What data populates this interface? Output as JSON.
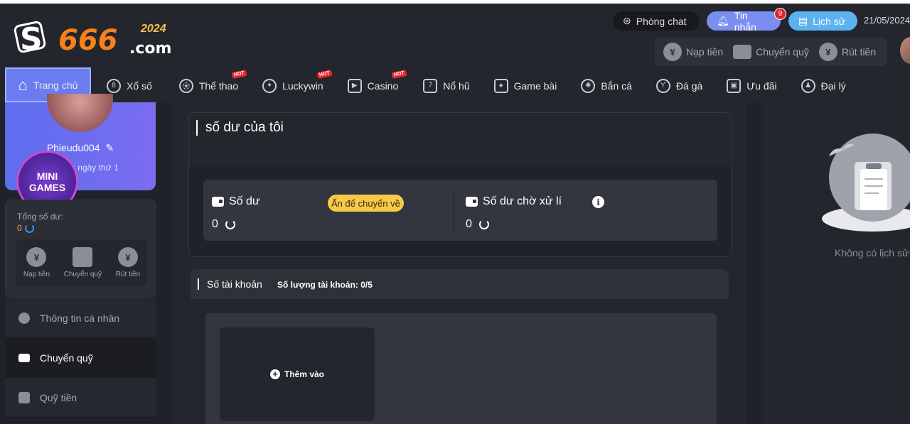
{
  "brand": {
    "logo_letters": "S",
    "logo_number": "666",
    "logo_domain": ".com",
    "logo_year": "2024"
  },
  "header": {
    "chat_label": "Phòng chat",
    "messages_label": "Tin nhắn",
    "messages_count": "9",
    "history_label": "Lịch sử",
    "date": "21/05/2024",
    "wallet": {
      "deposit": "Nạp tiền",
      "transfer": "Chuyển quỹ",
      "withdraw": "Rút tiền"
    }
  },
  "nav": {
    "items": [
      {
        "label": "Trang chủ",
        "icon": "home-icon",
        "hot": false,
        "active": true
      },
      {
        "label": "Xổ số",
        "icon": "lottery-icon",
        "hot": false
      },
      {
        "label": "Thể thao",
        "icon": "soccer-ball-icon",
        "hot": true
      },
      {
        "label": "Luckywin",
        "icon": "chip-icon",
        "hot": true
      },
      {
        "label": "Casino",
        "icon": "play-icon",
        "hot": true
      },
      {
        "label": "Nổ hũ",
        "icon": "slot-icon",
        "hot": false
      },
      {
        "label": "Game bài",
        "icon": "card-icon",
        "hot": false
      },
      {
        "label": "Bắn cá",
        "icon": "fish-icon",
        "hot": false
      },
      {
        "label": "Đá gà",
        "icon": "rooster-icon",
        "hot": false
      },
      {
        "label": "Ưu đãi",
        "icon": "gift-icon",
        "hot": false
      },
      {
        "label": "Đại lý",
        "icon": "agent-icon",
        "hot": false
      }
    ],
    "hot_label": "HOT"
  },
  "profile": {
    "username": "Phieudu004",
    "day_text": "n ngày thứ 1",
    "mini_games_line1": "MINI",
    "mini_games_line2": "GAMES"
  },
  "balance_box": {
    "total_label": "Tổng số dư:",
    "total_value": "0",
    "actions": [
      {
        "label": "Nạp tiền",
        "icon": "deposit-icon"
      },
      {
        "label": "Chuyển quỹ",
        "icon": "wallet-icon"
      },
      {
        "label": "Rút tiền",
        "icon": "withdraw-icon"
      }
    ]
  },
  "side_menu": [
    {
      "label": "Thông tin cá nhân",
      "icon": "user-icon",
      "active": false
    },
    {
      "label": "Chuyển quỹ",
      "icon": "wallet-icon",
      "active": true
    },
    {
      "label": "Quỹ tiền",
      "icon": "fund-icon",
      "active": false
    }
  ],
  "my_balance": {
    "title": "số dư của tôi",
    "balance_label": "Số dư",
    "balance_value": "0",
    "tap_transfer_label": "Ấn để chuyển về",
    "pending_label": "Số dư chờ xử lí",
    "pending_value": "0"
  },
  "accounts": {
    "title": "Số tài khoản",
    "count_label": "Số lượng tài khoản:",
    "count_value": "0/5",
    "add_label": "Thêm vào"
  },
  "history": {
    "empty_text": "Không có lịch sử"
  }
}
